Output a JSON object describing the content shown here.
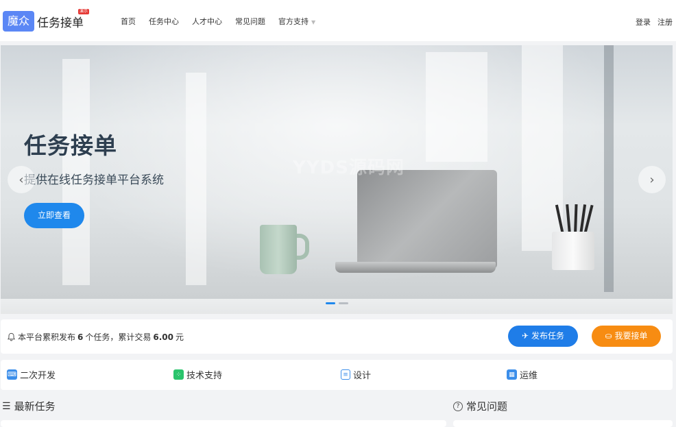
{
  "header": {
    "logo_badge": "魔众",
    "logo_text": "任务接单",
    "logo_tag": "演示",
    "nav": [
      {
        "label": "首页"
      },
      {
        "label": "任务中心"
      },
      {
        "label": "人才中心"
      },
      {
        "label": "常见问题"
      },
      {
        "label": "官方支持"
      }
    ],
    "login": "登录",
    "register": "注册"
  },
  "banner": {
    "title": "任务接单",
    "subtitle": "提供在线任务接单平台系统",
    "button": "立即查看",
    "watermark": "YYDS源码网",
    "prev_arrow": "‹",
    "next_arrow": "›",
    "active_slide": 1,
    "slide_count": 2
  },
  "stats": {
    "prefix": "本平台累积发布",
    "task_count": "6",
    "middle": "个任务，累计交易",
    "amount": "6.00",
    "suffix": "元",
    "publish_button": "发布任务",
    "accept_button": "我要接单"
  },
  "categories": [
    {
      "label": "二次开发",
      "icon": "code-icon",
      "color": "#3b8eea"
    },
    {
      "label": "技术支持",
      "icon": "grid-icon",
      "color": "#2ac46c"
    },
    {
      "label": "设计",
      "icon": "document-icon",
      "color": "#3b8eea"
    },
    {
      "label": "运维",
      "icon": "server-icon",
      "color": "#3b8eea"
    }
  ],
  "sections": {
    "latest_tasks": "最新任务",
    "faq": "常见问题"
  }
}
